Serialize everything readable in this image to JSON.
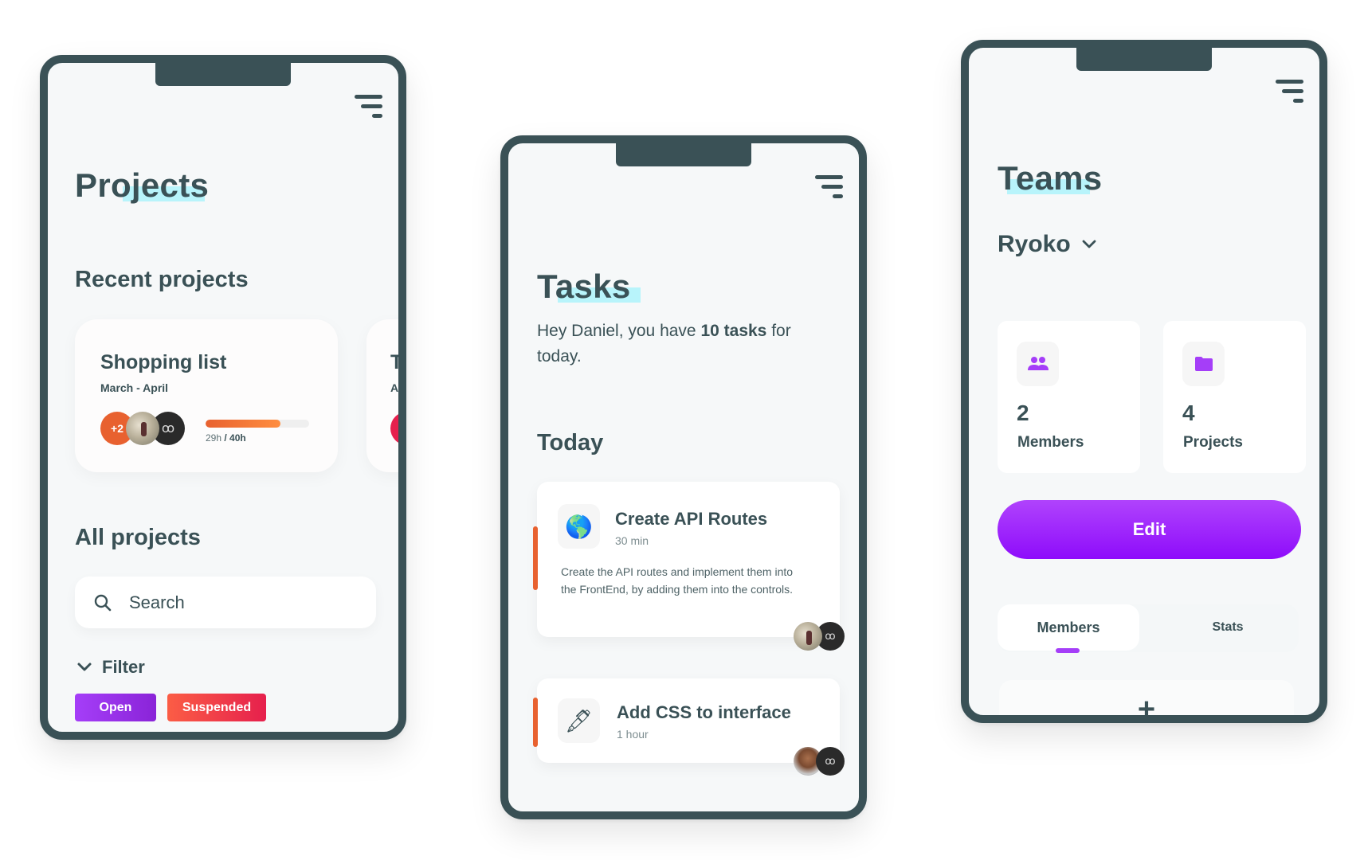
{
  "projects_screen": {
    "title": "Projects",
    "recent_heading": "Recent projects",
    "recent_projects": [
      {
        "name": "Shopping list",
        "dates": "March - April",
        "extra_members": "+2",
        "hours_spent": "29h",
        "hours_total": "40h",
        "progress": 0.725,
        "accent": "#e8612f"
      },
      {
        "name": "T",
        "dates": "A",
        "accent": "#e6204d"
      }
    ],
    "all_heading": "All projects",
    "search": {
      "placeholder": "Search",
      "value": ""
    },
    "filter_label": "Filter",
    "filters": [
      {
        "label": "Open",
        "color": "#a53ef8"
      },
      {
        "label": "Suspended",
        "color": "#fb5d45"
      }
    ]
  },
  "tasks_screen": {
    "title": "Tasks",
    "greeting_prefix": "Hey Daniel, you have ",
    "greeting_bold": "10 tasks",
    "greeting_suffix": " for today.",
    "today_heading": "Today",
    "tasks": [
      {
        "icon": "globe-icon",
        "icon_glyph": "🌎",
        "title": "Create API Routes",
        "duration": "30 min",
        "description": "Create the API routes and implement them into the FrontEnd, by adding them into the controls."
      },
      {
        "icon": "pen-icon",
        "icon_glyph": "🖋",
        "title": "Add CSS to interface",
        "duration": "1 hour",
        "description": ""
      }
    ]
  },
  "teams_screen": {
    "title": "Teams",
    "team_name": "Ryoko",
    "stats": [
      {
        "icon": "people-icon",
        "value": "2",
        "label": "Members"
      },
      {
        "icon": "folder-icon",
        "value": "4",
        "label": "Projects"
      }
    ],
    "edit_label": "Edit",
    "tabs": [
      {
        "label": "Members",
        "active": true
      },
      {
        "label": "Stats",
        "active": false
      }
    ],
    "add_label": "+",
    "accent": "#a53ef8"
  },
  "logo_glyph": "ꝏ"
}
